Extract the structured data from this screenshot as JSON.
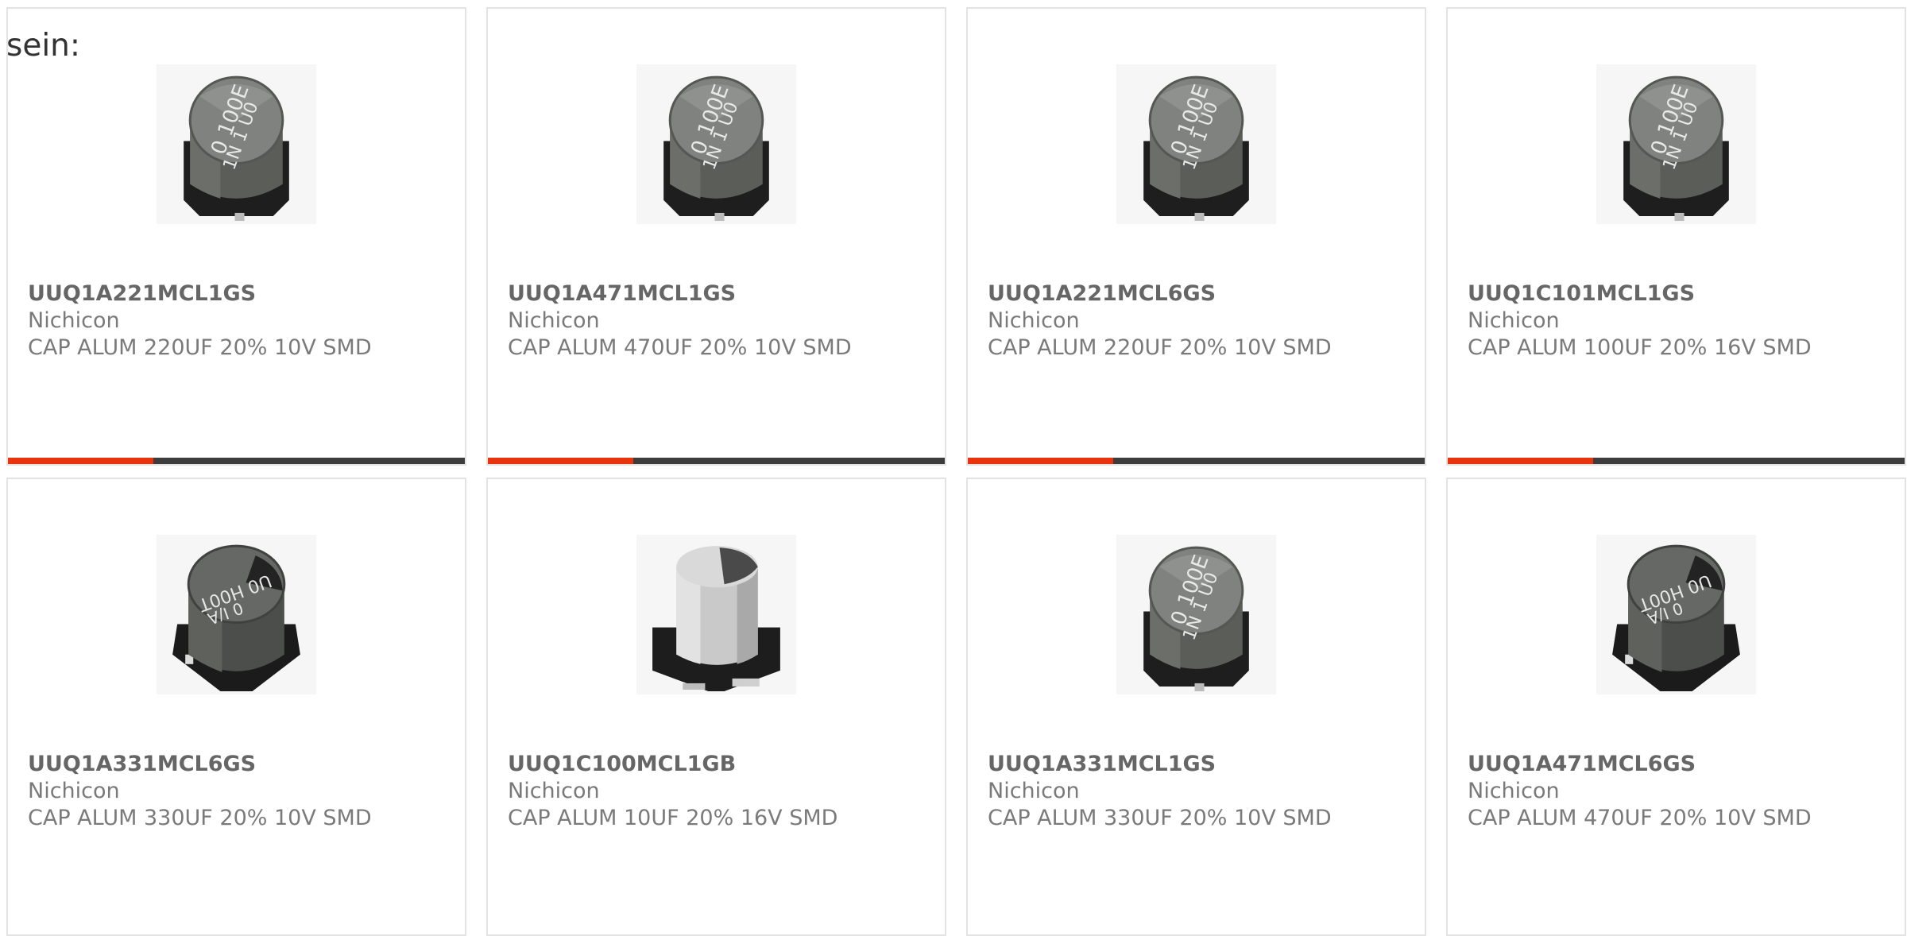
{
  "intro_text": "sein:",
  "colors": {
    "accent": "#e8330d",
    "bar": "#3d3d3d",
    "border": "#e3e3e3",
    "text": "#7a7a7a"
  },
  "products": [
    {
      "part": "UUQ1A221MCL1GS",
      "manufacturer": "Nichicon",
      "description": "CAP ALUM 220UF 20% 10V SMD",
      "image": "capacitor-dark-top-icon"
    },
    {
      "part": "UUQ1A471MCL1GS",
      "manufacturer": "Nichicon",
      "description": "CAP ALUM 470UF 20% 10V SMD",
      "image": "capacitor-dark-top-icon"
    },
    {
      "part": "UUQ1A221MCL6GS",
      "manufacturer": "Nichicon",
      "description": "CAP ALUM 220UF 20% 10V SMD",
      "image": "capacitor-dark-top-icon"
    },
    {
      "part": "UUQ1C101MCL1GS",
      "manufacturer": "Nichicon",
      "description": "CAP ALUM 100UF 20% 16V SMD",
      "image": "capacitor-dark-top-icon"
    },
    {
      "part": "UUQ1A331MCL6GS",
      "manufacturer": "Nichicon",
      "description": "CAP ALUM 330UF 20% 10V SMD",
      "image": "capacitor-dark-side-icon"
    },
    {
      "part": "UUQ1C100MCL1GB",
      "manufacturer": "Nichicon",
      "description": "CAP ALUM 10UF 20% 16V SMD",
      "image": "capacitor-silver-icon"
    },
    {
      "part": "UUQ1A331MCL1GS",
      "manufacturer": "Nichicon",
      "description": "CAP ALUM 330UF 20% 10V SMD",
      "image": "capacitor-dark-top-icon"
    },
    {
      "part": "UUQ1A471MCL6GS",
      "manufacturer": "Nichicon",
      "description": "CAP ALUM 470UF 20% 10V SMD",
      "image": "capacitor-dark-side-icon"
    }
  ]
}
